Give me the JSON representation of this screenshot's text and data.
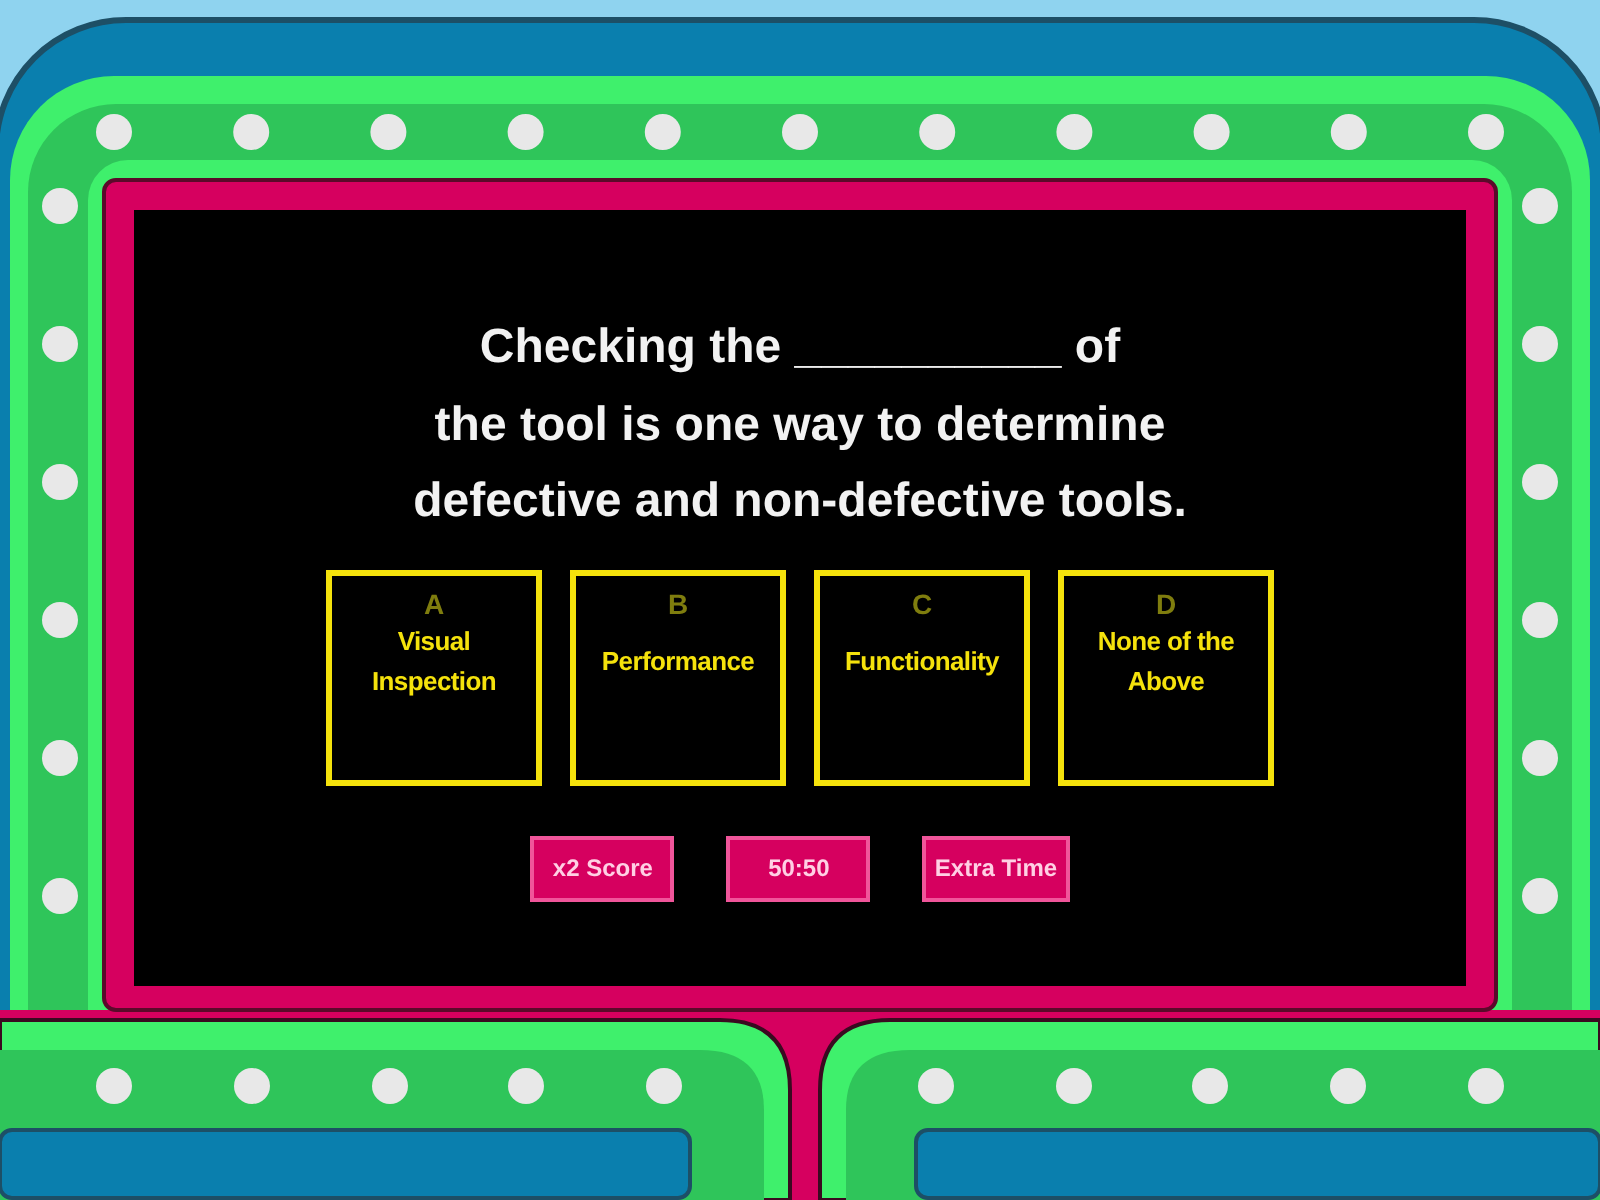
{
  "question_lines": [
    "Checking the __________ of",
    "the tool is one way to determine",
    "defective and non-defective tools."
  ],
  "answers": [
    {
      "letter": "A",
      "text": "Visual Inspection"
    },
    {
      "letter": "B",
      "text": "Performance"
    },
    {
      "letter": "C",
      "text": "Functionality"
    },
    {
      "letter": "D",
      "text": "None of the Above"
    }
  ],
  "powerups": [
    "x2 Score",
    "50:50",
    "Extra Time"
  ]
}
